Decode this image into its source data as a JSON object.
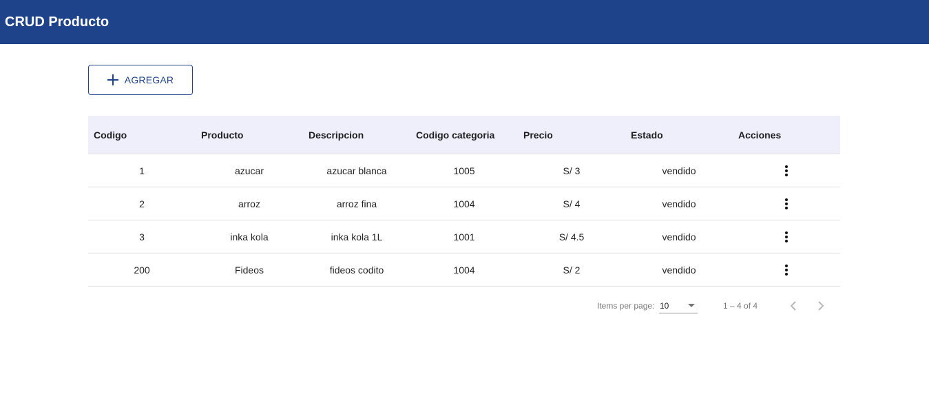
{
  "toolbar": {
    "title": "CRUD Producto"
  },
  "actions": {
    "add_label": "AGREGAR",
    "add_icon": "plus-icon"
  },
  "colors": {
    "primary": "#1e438b",
    "header_bg": "#efeefb"
  },
  "table": {
    "columns": [
      "Codigo",
      "Producto",
      "Descripcion",
      "Codigo categoria",
      "Precio",
      "Estado",
      "Acciones"
    ],
    "rows": [
      {
        "codigo": "1",
        "producto": "azucar",
        "descripcion": "azucar blanca",
        "categoria": "1005",
        "precio": "S/ 3",
        "estado": "vendido",
        "menu_icon": "more-vert-icon"
      },
      {
        "codigo": "2",
        "producto": "arroz",
        "descripcion": "arroz fina",
        "categoria": "1004",
        "precio": "S/ 4",
        "estado": "vendido",
        "menu_icon": "more-vert-icon"
      },
      {
        "codigo": "3",
        "producto": "inka kola",
        "descripcion": "inka kola 1L",
        "categoria": "1001",
        "precio": "S/ 4.5",
        "estado": "vendido",
        "menu_icon": "more-vert-icon"
      },
      {
        "codigo": "200",
        "producto": "Fideos",
        "descripcion": "fideos codito",
        "categoria": "1004",
        "precio": "S/ 2",
        "estado": "vendido",
        "menu_icon": "more-vert-icon"
      }
    ]
  },
  "paginator": {
    "items_per_page_label": "Items per page:",
    "page_size": "10",
    "range_label": "1 – 4 of 4",
    "prev_icon": "chevron-left-icon",
    "next_icon": "chevron-right-icon"
  }
}
